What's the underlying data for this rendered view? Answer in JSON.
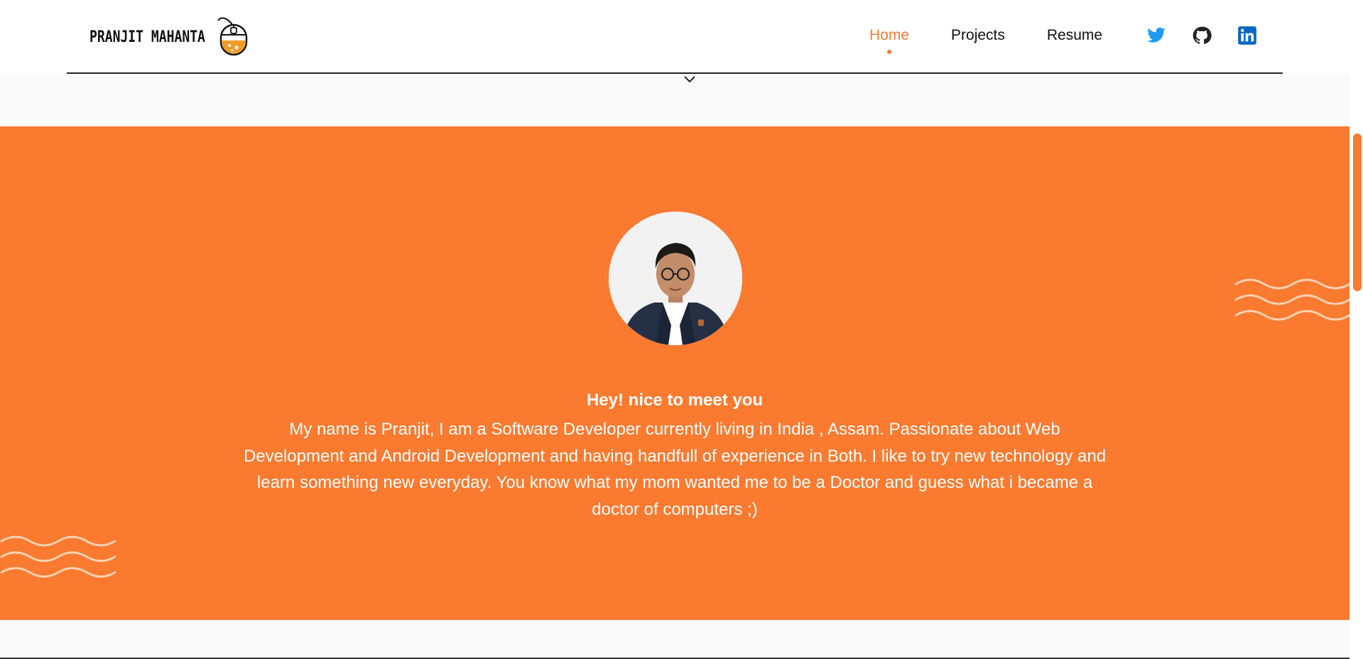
{
  "brand": {
    "name": "PRANJIT MAHANTA",
    "logo_icon": "mouse-logo-icon"
  },
  "nav": {
    "items": [
      {
        "label": "Home",
        "active": true
      },
      {
        "label": "Projects",
        "active": false
      },
      {
        "label": "Resume",
        "active": false
      }
    ],
    "socials": [
      {
        "icon": "twitter-icon",
        "color": "#1d9bf0"
      },
      {
        "icon": "github-icon",
        "color": "#222222"
      },
      {
        "icon": "linkedin-icon",
        "color": "#0a66c2"
      }
    ],
    "scroll_indicator_icon": "chevron-down-icon"
  },
  "hero": {
    "title": "Hey! nice to meet you",
    "text": "My name is Pranjit, I am a Software Developer currently living in India , Assam. Passionate about Web Development and Android Development and having handfull of experience in Both. I like to try new technology and learn something new everyday. You know what my mom wanted me to be a Doctor and guess what i became a doctor of computers ;)",
    "avatar_icon": "profile-photo",
    "background_color": "#fa7a30"
  },
  "colors": {
    "accent": "#f97a31",
    "text": "#111111",
    "page_bg": "#fafafa"
  }
}
